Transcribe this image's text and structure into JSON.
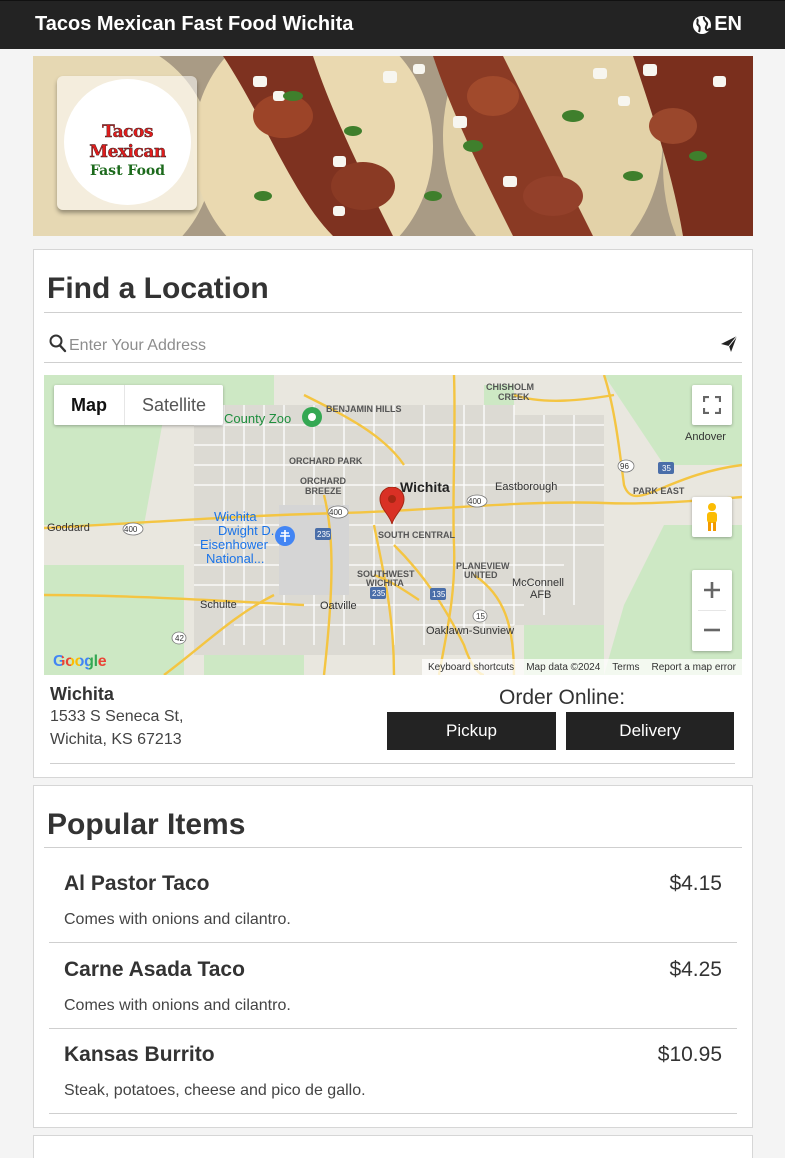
{
  "header": {
    "title": "Tacos Mexican Fast Food Wichita",
    "language": "EN"
  },
  "logo": {
    "line1": "Tacos Mexican",
    "line2": "Fast Food"
  },
  "find_location": {
    "heading": "Find a Location",
    "search_placeholder": "Enter Your Address"
  },
  "map": {
    "type_map": "Map",
    "type_satellite": "Satellite",
    "labels": {
      "chisholm": "CHISHOLM",
      "creek": "CREEK",
      "zoo": "County Zoo",
      "benjamin": "BENJAMIN HILLS",
      "andover": "Andover",
      "orchard_park": "ORCHARD PARK",
      "orchard": "ORCHARD",
      "breeze": "BREEZE",
      "wichita": "Wichita",
      "eastborough": "Eastborough",
      "park_east": "PARK EAST",
      "goddard": "Goddard",
      "airport1": "Wichita",
      "airport2": "Dwight D.",
      "airport3": "Eisenhower",
      "airport4": "National...",
      "south_central": "SOUTH CENTRAL",
      "southwest": "SOUTHWEST",
      "southwest2": "WICHITA",
      "planeview": "PLANEVIEW",
      "united": "UNITED",
      "mcconnell": "McConnell",
      "afb": "AFB",
      "schulte": "Schulte",
      "oatville": "Oatville",
      "oaklawn": "Oaklawn-Sunview",
      "r400a": "400",
      "r400b": "400",
      "r400c": "400",
      "r235a": "235",
      "r235b": "235",
      "r135": "135",
      "r96": "96",
      "r35": "35",
      "r42": "42",
      "r15": "15"
    },
    "google": "Google",
    "attribution": [
      "Keyboard shortcuts",
      "Map data ©2024",
      "Terms",
      "Report a map error"
    ]
  },
  "location": {
    "name": "Wichita",
    "address_line1": "1533 S Seneca St,",
    "address_line2": "Wichita, KS 67213",
    "order_label": "Order Online:",
    "pickup": "Pickup",
    "delivery": "Delivery"
  },
  "popular": {
    "heading": "Popular Items",
    "items": [
      {
        "name": "Al Pastor Taco",
        "price": "$4.15",
        "description": "Comes with onions and cilantro."
      },
      {
        "name": "Carne Asada Taco",
        "price": "$4.25",
        "description": "Comes with onions and cilantro."
      },
      {
        "name": "Kansas Burrito",
        "price": "$10.95",
        "description": "Steak, potatoes, cheese and pico de gallo."
      }
    ]
  },
  "colors": {
    "topbar": "#232323",
    "button": "#232323",
    "map_pin": "#d93025"
  }
}
